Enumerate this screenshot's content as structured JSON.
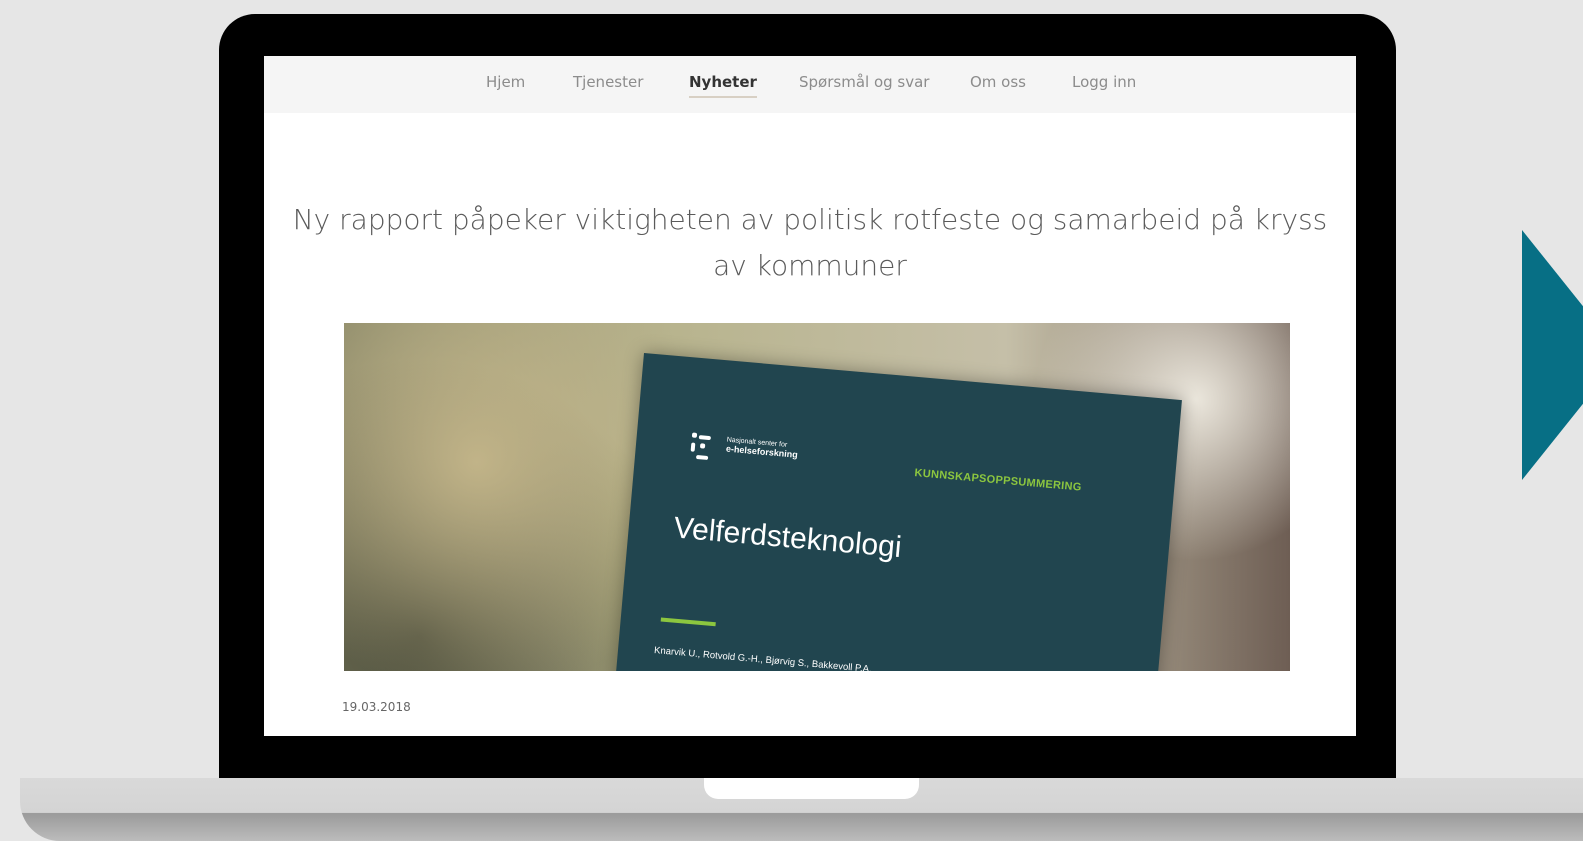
{
  "nav": {
    "items": [
      {
        "label": "Hjem"
      },
      {
        "label": "Tjenester"
      },
      {
        "label": "Nyheter",
        "active": true
      },
      {
        "label": "Spørsmål og svar"
      },
      {
        "label": "Om oss"
      },
      {
        "label": "Logg inn"
      }
    ]
  },
  "article": {
    "headline": "Ny rapport påpeker viktigheten av politisk rotfeste og samarbeid på kryss av kommuner",
    "date": "19.03.2018"
  },
  "hero_image": {
    "org_line1": "Nasjonalt senter for",
    "org_line2": "e-helseforskning",
    "kicker": "KUNNSKAPSOPPSUMMERING",
    "title": "Velferdsteknologi",
    "authors": "Knarvik U., Rotvold G.-H., Bjørvig S., Bakkevoll P.A."
  },
  "colors": {
    "accent_arrow": "#076f85",
    "report_background": "#21454f",
    "report_green": "#8cc63f"
  }
}
